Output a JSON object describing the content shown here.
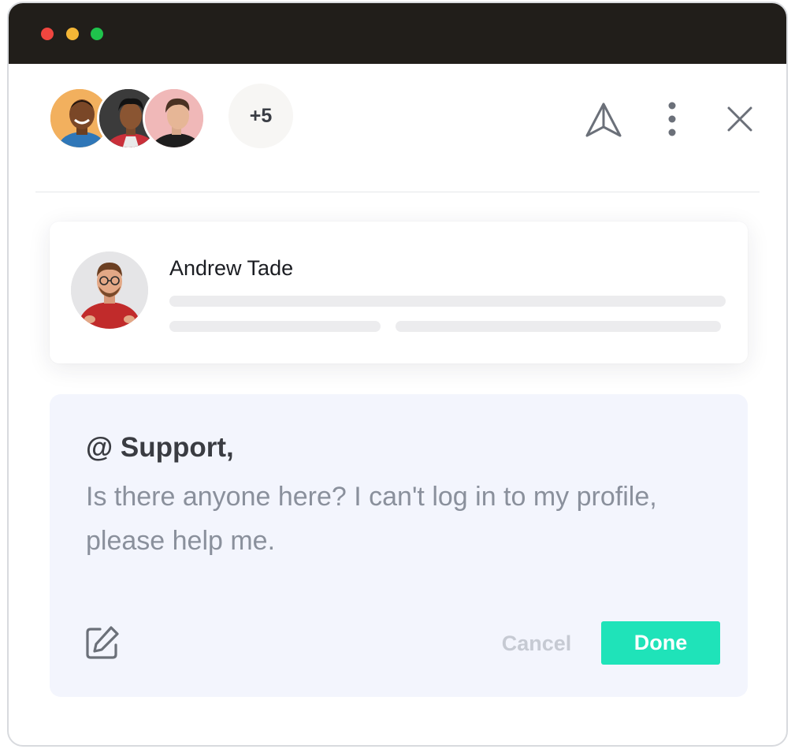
{
  "window": {
    "controls": [
      "close",
      "minimize",
      "maximize"
    ],
    "colors": {
      "titlebar": "#211e1a",
      "close": "#f0463f",
      "minimize": "#f4b636",
      "maximize": "#1fc34c"
    }
  },
  "header": {
    "participants": [
      {
        "name": "participant-1",
        "bg": "#f2b05e"
      },
      {
        "name": "participant-2",
        "bg": "#3b3b3b"
      },
      {
        "name": "participant-3",
        "bg": "#f0b8b8"
      }
    ],
    "more_count": "+5",
    "icons": [
      "send-icon",
      "more-vertical-icon",
      "close-icon"
    ]
  },
  "card": {
    "name": "Andrew Tade"
  },
  "message": {
    "mention": "@ Support,",
    "text": "Is there anyone here? I can't log in to my profile, please help me.",
    "cancel_label": "Cancel",
    "done_label": "Done",
    "accent": "#1fe3b9",
    "background": "#f3f5fd"
  }
}
